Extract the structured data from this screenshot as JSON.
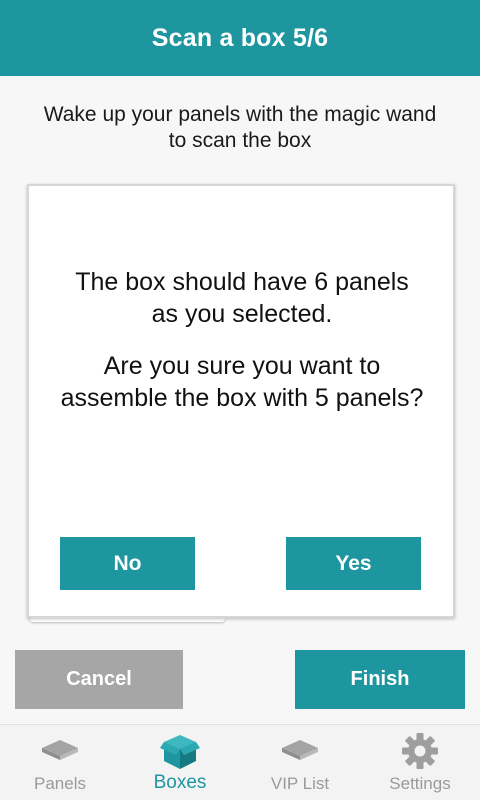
{
  "header": {
    "title": "Scan a box 5/6"
  },
  "instruction": "Wake up your panels with the magic wand to scan the box",
  "dialog": {
    "message1": "The box should have 6 panels as you selected.",
    "message2": "Are you sure you want to assemble the box with 5 panels?",
    "no_label": "No",
    "yes_label": "Yes"
  },
  "actions": {
    "cancel_label": "Cancel",
    "finish_label": "Finish"
  },
  "nav": {
    "items": [
      {
        "label": "Panels",
        "icon": "panel-icon",
        "active": false
      },
      {
        "label": "Boxes",
        "icon": "box-icon",
        "active": true
      },
      {
        "label": "VIP List",
        "icon": "vip-list-icon",
        "active": false
      },
      {
        "label": "Settings",
        "icon": "gear-icon",
        "active": false
      }
    ]
  },
  "colors": {
    "accent": "#1e96a0",
    "inactive": "#9a9a9a",
    "cancel": "#a6a6a6"
  }
}
